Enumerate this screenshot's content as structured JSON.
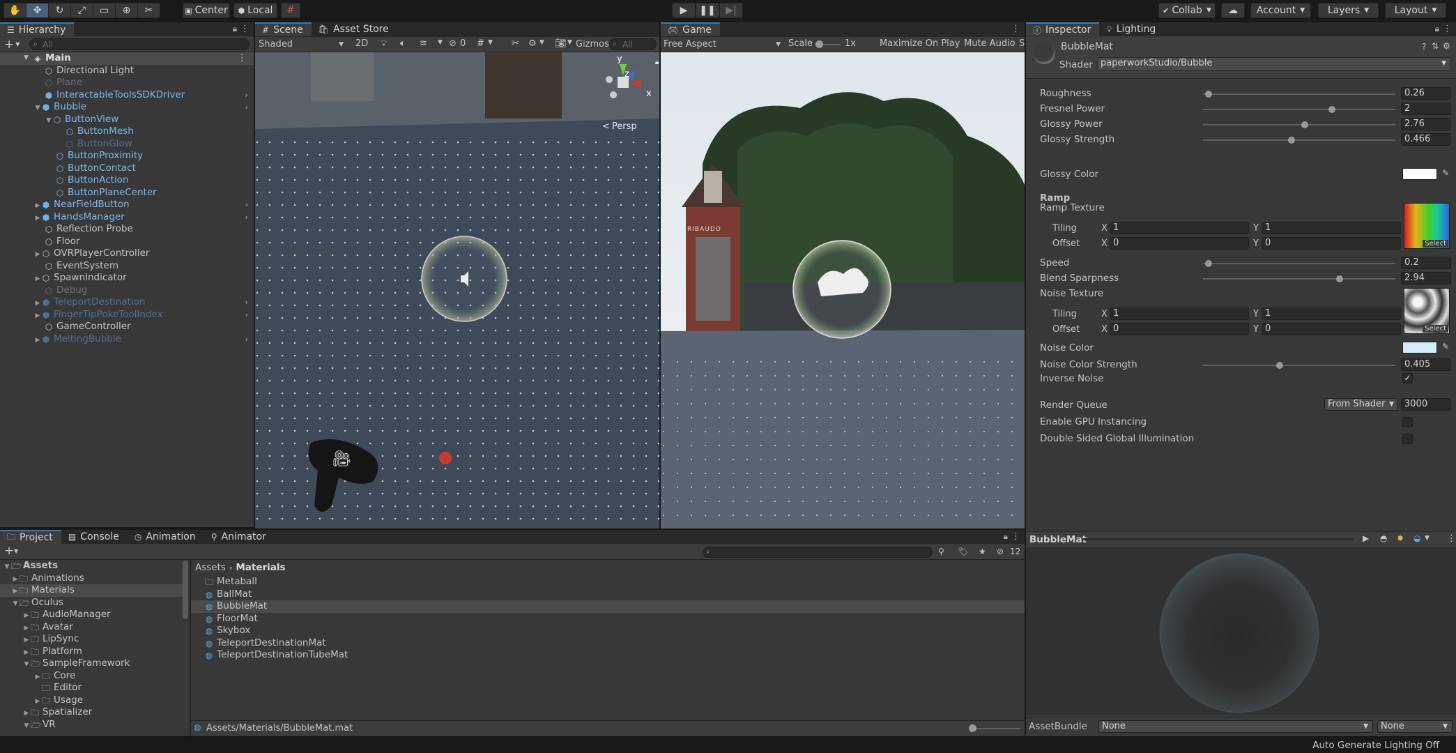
{
  "toolbar": {
    "pivot_label": "Center",
    "space_label": "Local",
    "collab_label": "Collab",
    "account_label": "Account",
    "layers_label": "Layers",
    "layout_label": "Layout"
  },
  "hierarchy": {
    "tab": "Hierarchy",
    "search_placeholder": "All",
    "scene": "Main",
    "items": [
      {
        "label": "Directional Light"
      },
      {
        "label": "Plane"
      },
      {
        "label": "InteractableToolsSDKDriver"
      },
      {
        "label": "Bubble"
      },
      {
        "label": "ButtonView"
      },
      {
        "label": "ButtonMesh"
      },
      {
        "label": "ButtonGlow"
      },
      {
        "label": "ButtonProximity"
      },
      {
        "label": "ButtonContact"
      },
      {
        "label": "ButtonAction"
      },
      {
        "label": "ButtonPlaneCenter"
      },
      {
        "label": "NearFieldButton"
      },
      {
        "label": "HandsManager"
      },
      {
        "label": "Reflection Probe"
      },
      {
        "label": "Floor"
      },
      {
        "label": "OVRPlayerController"
      },
      {
        "label": "EventSystem"
      },
      {
        "label": "SpawnIndicator"
      },
      {
        "label": "Debug"
      },
      {
        "label": "TeleportDestination"
      },
      {
        "label": "FingerTipPokeToolIndex"
      },
      {
        "label": "GameController"
      },
      {
        "label": "MeltingBubble"
      }
    ]
  },
  "scene_view": {
    "tabs": [
      "Scene",
      "Asset Store"
    ],
    "shading": "Shaded",
    "mode_2d": "2D",
    "hidden_count": "0",
    "gizmos": "Gizmos",
    "search_placeholder": "All",
    "persp": "Persp",
    "axis_y": "y",
    "axis_x": "x",
    "axis_z": "z"
  },
  "game_view": {
    "tab": "Game",
    "aspect": "Free Aspect",
    "scale_label": "Scale",
    "scale_value": "1x",
    "maximize": "Maximize On Play",
    "mute": "Mute Audio",
    "stats_partial": "S",
    "sign_text": "RIBAUDO"
  },
  "inspector": {
    "tabs": [
      "Inspector",
      "Lighting"
    ],
    "material_name": "BubbleMat",
    "shader_label": "Shader",
    "shader_value": "paperworkStudio/Bubble",
    "props": [
      {
        "label": "Roughness",
        "value": "0.26",
        "level": 0.03
      },
      {
        "label": "Fresnel Power",
        "value": "2",
        "level": 0.67
      },
      {
        "label": "Glossy Power",
        "value": "2.76",
        "level": 0.53
      },
      {
        "label": "Glossy Strength",
        "value": "0.466",
        "level": 0.46
      }
    ],
    "glossy_color_label": "Glossy Color",
    "ramp_header": "Ramp",
    "ramp_texture_label": "Ramp Texture",
    "tiling_label": "Tiling",
    "offset_label": "Offset",
    "x_label": "X",
    "y_label": "Y",
    "ramp_tiling": {
      "x": "1",
      "y": "1"
    },
    "ramp_offset": {
      "x": "0",
      "y": "0"
    },
    "select_label": "Select",
    "speed": {
      "label": "Speed",
      "value": "0.2",
      "level": 0.03
    },
    "blend": {
      "label": "Blend Sparpness",
      "value": "2.94",
      "level": 0.71
    },
    "noise_texture_label": "Noise Texture",
    "noise_tiling": {
      "x": "1",
      "y": "1"
    },
    "noise_offset": {
      "x": "0",
      "y": "0"
    },
    "noise_color_label": "Noise Color",
    "noise_strength": {
      "label": "Noise Color Strength",
      "value": "0.405",
      "level": 0.4
    },
    "inverse_noise_label": "Inverse Noise",
    "inverse_noise_checked": true,
    "render_queue_label": "Render Queue",
    "render_queue_mode": "From Shader",
    "render_queue_value": "3000",
    "gpu_instancing_label": "Enable GPU Instancing",
    "double_sided_label": "Double Sided Global Illumination",
    "preview_title": "BubbleMat",
    "assetbundle_label": "AssetBundle",
    "assetbundle_value": "None",
    "assetbundle_variant": "None",
    "colors": {
      "glossy": "#ffffff",
      "noise": "#d7ecfa",
      "accent": "#3a79bb"
    }
  },
  "project": {
    "tabs": [
      "Project",
      "Console",
      "Animation",
      "Animator"
    ],
    "search_placeholder": "",
    "hidden_count": "12",
    "breadcrumb_root": "Assets",
    "breadcrumb_leaf": "Materials",
    "tree": [
      {
        "label": "Assets"
      },
      {
        "label": "Animations"
      },
      {
        "label": "Materials"
      },
      {
        "label": "Oculus"
      },
      {
        "label": "AudioManager"
      },
      {
        "label": "Avatar"
      },
      {
        "label": "LipSync"
      },
      {
        "label": "Platform"
      },
      {
        "label": "SampleFramework"
      },
      {
        "label": "Core"
      },
      {
        "label": "Editor"
      },
      {
        "label": "Usage"
      },
      {
        "label": "Spatializer"
      },
      {
        "label": "VR"
      }
    ],
    "files": [
      {
        "label": "Metaball",
        "kind": "folder"
      },
      {
        "label": "BallMat",
        "kind": "material"
      },
      {
        "label": "BubbleMat",
        "kind": "material"
      },
      {
        "label": "FloorMat",
        "kind": "material"
      },
      {
        "label": "Skybox",
        "kind": "material"
      },
      {
        "label": "TeleportDestinationMat",
        "kind": "material"
      },
      {
        "label": "TeleportDestinationTubeMat",
        "kind": "material"
      }
    ],
    "path": "Assets/Materials/BubbleMat.mat"
  },
  "status_bar": {
    "text": "Auto Generate Lighting Off"
  }
}
